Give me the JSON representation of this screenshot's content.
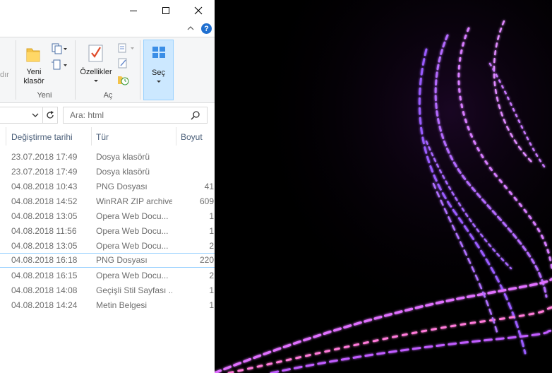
{
  "window": {
    "minimize": "minimize",
    "maximize": "maximize",
    "close": "close"
  },
  "ribbon": {
    "partial_label": "dır",
    "new_folder_label": "Yeni\nklasör",
    "group_new": "Yeni",
    "properties_label": "Özellikler",
    "group_open": "Aç",
    "select_label": "Seç"
  },
  "search": {
    "placeholder": "Ara: html"
  },
  "columns": {
    "date": "Değiştirme tarihi",
    "type": "Tür",
    "size": "Boyut"
  },
  "files": [
    {
      "date": "23.07.2018 17:49",
      "type": "Dosya klasörü",
      "size": ""
    },
    {
      "date": "23.07.2018 17:49",
      "type": "Dosya klasörü",
      "size": ""
    },
    {
      "date": "04.08.2018 10:43",
      "type": "PNG Dosyası",
      "size": "41"
    },
    {
      "date": "04.08.2018 14:52",
      "type": "WinRAR ZIP archive",
      "size": "609"
    },
    {
      "date": "04.08.2018 13:05",
      "type": "Opera Web Docu...",
      "size": "1"
    },
    {
      "date": "04.08.2018 11:56",
      "type": "Opera Web Docu...",
      "size": "1"
    },
    {
      "date": "04.08.2018 13:05",
      "type": "Opera Web Docu...",
      "size": "2"
    },
    {
      "date": "04.08.2018 16:18",
      "type": "PNG Dosyası",
      "size": "220"
    },
    {
      "date": "04.08.2018 16:15",
      "type": "Opera Web Docu...",
      "size": "2"
    },
    {
      "date": "04.08.2018 14:08",
      "type": "Geçişli Stil Sayfası ...",
      "size": "1"
    },
    {
      "date": "04.08.2018 14:24",
      "type": "Metin Belgesi",
      "size": "1"
    }
  ],
  "colors": {
    "accent": "#0078d7",
    "select_border": "#99d1ff",
    "header_text": "#4c607a",
    "wallpaper_glow": "#c060ff"
  }
}
